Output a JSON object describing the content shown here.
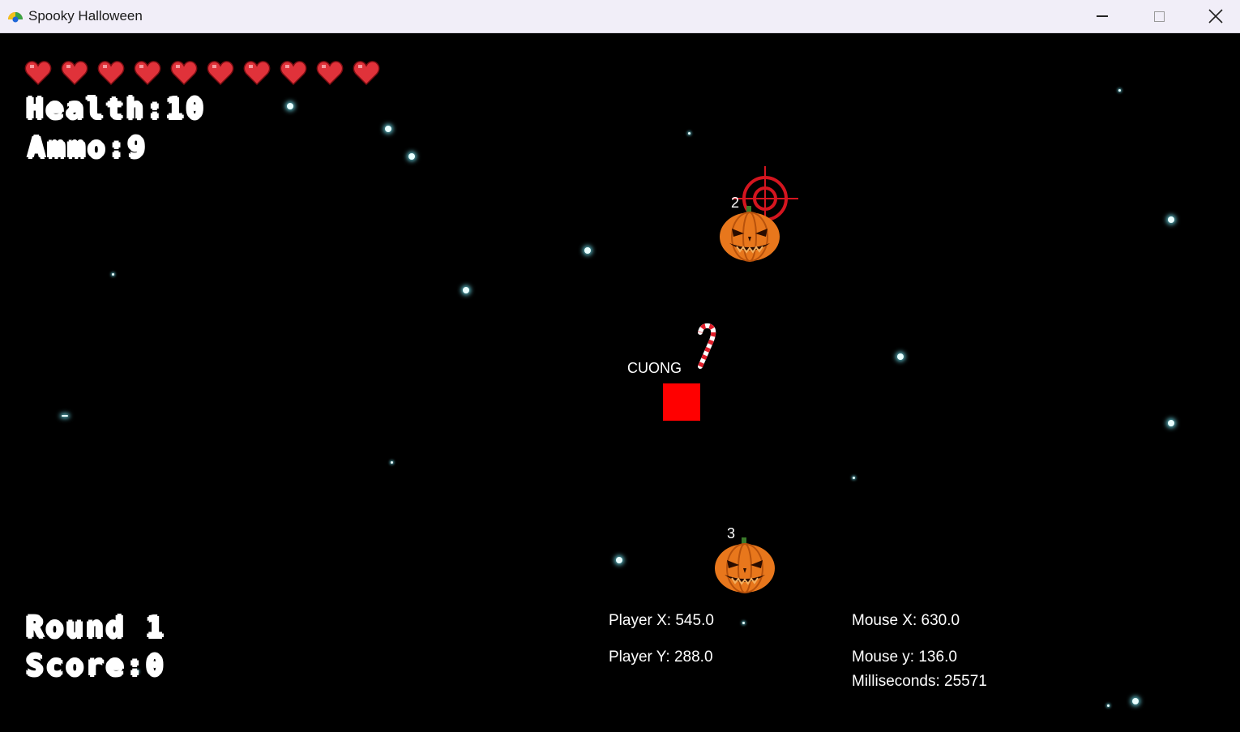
{
  "window": {
    "title": "Spooky Halloween",
    "controls": [
      "minimize",
      "maximize",
      "close"
    ]
  },
  "hud": {
    "hearts": 10,
    "heart_color": "#e0323a",
    "health_label": "Health:10",
    "ammo_label": "Ammo:9",
    "round_label": "Round 1",
    "score_label": "Score:0"
  },
  "player": {
    "name": "CUONG",
    "color": "#ff0000"
  },
  "enemies": [
    {
      "label": "2",
      "type": "pumpkin"
    },
    {
      "label": "3",
      "type": "pumpkin"
    }
  ],
  "pickups": [
    {
      "type": "candy-cane"
    }
  ],
  "crosshair": {
    "color": "#d4151f"
  },
  "debug": {
    "player_x": "Player X: 545.0",
    "player_y": "Player Y: 288.0",
    "mouse_x": "Mouse X: 630.0",
    "mouse_y": "Mouse y: 136.0",
    "milliseconds": "Milliseconds: 25571"
  },
  "colors": {
    "background": "#000000",
    "star": "#e9ffff",
    "titlebar": "#f1eef8"
  }
}
